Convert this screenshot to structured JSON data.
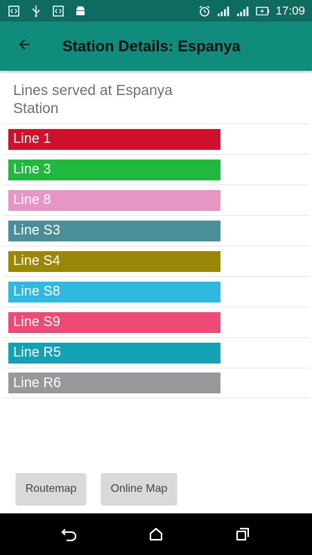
{
  "status_bar": {
    "time": "17:09",
    "icons": [
      "code-icon",
      "usb-icon",
      "code-icon",
      "android-icon",
      "alarm-icon",
      "signal-icon",
      "signal-2-icon",
      "battery-charging-icon"
    ]
  },
  "app_bar": {
    "title": "Station Details: Espanya",
    "back_icon": "arrow-back-icon"
  },
  "content": {
    "heading": "Lines served at Espanya Station",
    "lines": [
      {
        "label": "Line 1",
        "color": "#d0112b"
      },
      {
        "label": "Line 3",
        "color": "#20b83f"
      },
      {
        "label": "Line 8",
        "color": "#e795c2"
      },
      {
        "label": "Line S3",
        "color": "#4a8f97"
      },
      {
        "label": "Line S4",
        "color": "#9a8706"
      },
      {
        "label": "Line S8",
        "color": "#30b9e0"
      },
      {
        "label": "Line S9",
        "color": "#ef4a76"
      },
      {
        "label": "Line R5",
        "color": "#12a2b4"
      },
      {
        "label": "Line R6",
        "color": "#98989c"
      }
    ]
  },
  "buttons": {
    "routemap": "Routemap",
    "online_map": "Online Map"
  },
  "nav_bar": {
    "icons": [
      "back-nav-icon",
      "home-nav-icon",
      "recents-nav-icon"
    ]
  }
}
